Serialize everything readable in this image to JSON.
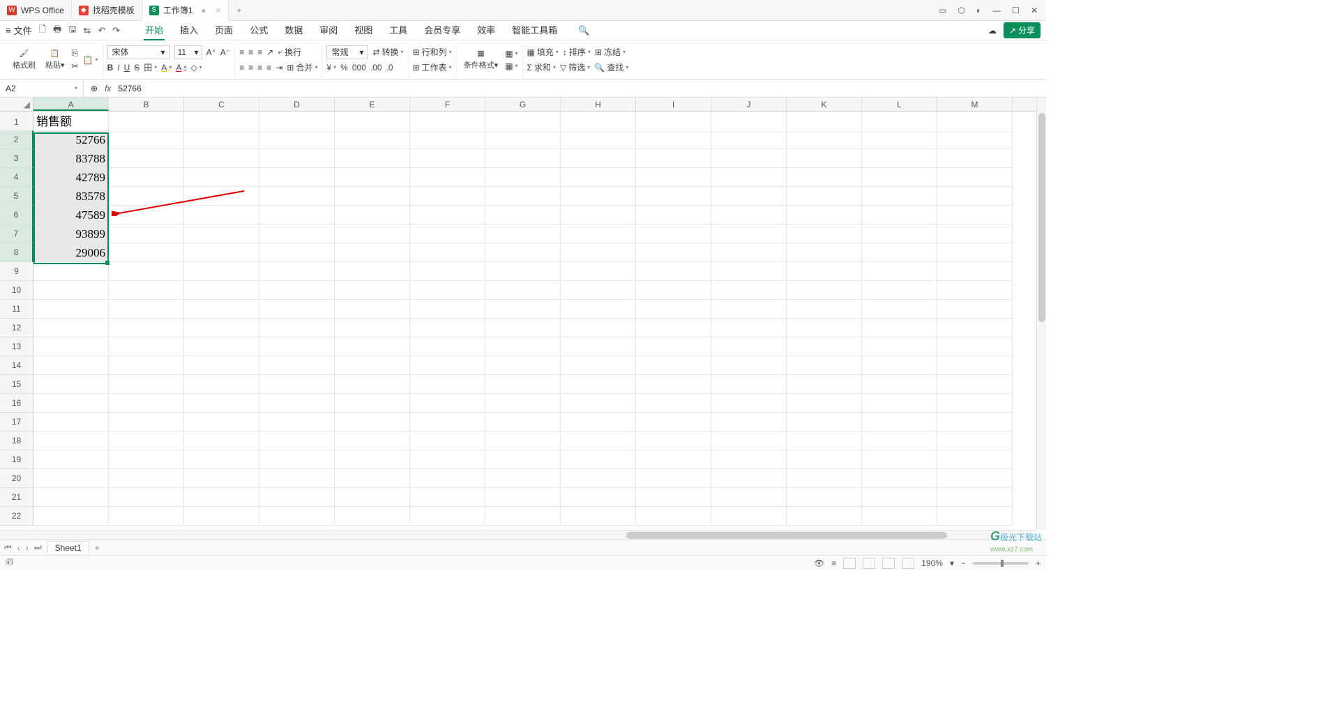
{
  "titlebar": {
    "tabs": [
      {
        "icon_bg": "#d23c2a",
        "icon_txt": "W",
        "label": "WPS Office"
      },
      {
        "icon_bg": "#e83f2e",
        "icon_txt": "◆",
        "label": "找稻壳模板"
      },
      {
        "icon_bg": "#0a8f5b",
        "icon_txt": "S",
        "label": "工作簿1",
        "active": true,
        "modified": "●"
      }
    ],
    "add": "+",
    "win": {
      "panel": "▭",
      "cube": "⬡",
      "avatar": "◐",
      "min": "—",
      "max": "☐",
      "close": "✕"
    }
  },
  "quickbar": {
    "menu_icon": "≡",
    "file_label": "文件",
    "icons": [
      "🗋",
      "🖶",
      "🖫",
      "⇆",
      "↶",
      "↷"
    ],
    "tabs": [
      "开始",
      "插入",
      "页面",
      "公式",
      "数据",
      "审阅",
      "视图",
      "工具",
      "会员专享",
      "效率",
      "智能工具箱"
    ],
    "active_tab": "开始",
    "search": "🔍",
    "cloud": "☁",
    "share_label": "分享"
  },
  "ribbon": {
    "clipboard": {
      "brush": "格式刷",
      "paste": "粘贴",
      "copy": "⎘",
      "cut": "✂"
    },
    "font": {
      "name": "宋体",
      "size": "11",
      "grow": "A⁺",
      "shrink": "A⁻",
      "bold": "B",
      "italic": "I",
      "uline": "U",
      "strike": "S",
      "borders": "田",
      "fill": "A",
      "color": "A",
      "clear": "◇"
    },
    "align": {
      "top": "≡",
      "mid": "≡",
      "bot": "≡",
      "orient": "↗",
      "wrap": "换行",
      "left": "≡",
      "center": "≡",
      "right": "≡",
      "just": "≡",
      "indent": "⇥",
      "merge": "合并"
    },
    "number": {
      "fmt": "常规",
      "convert": "转换",
      "cur": "¥",
      "pct": "%",
      "comma": "000",
      "inc": ".00",
      "dec": ".0"
    },
    "cells": {
      "rowcol": "行和列",
      "sheet": "工作表"
    },
    "style": {
      "cond": "条件格式",
      "cell": "▦"
    },
    "edit": {
      "fill": "填充",
      "sort": "排序",
      "freeze": "冻结",
      "sum": "求和",
      "filter": "筛选",
      "find": "查找"
    }
  },
  "formula_bar": {
    "cell": "A2",
    "fx": "fx",
    "value": "52766",
    "zoom": "⊕"
  },
  "grid": {
    "columns": [
      "A",
      "B",
      "C",
      "D",
      "E",
      "F",
      "G",
      "H",
      "I",
      "J",
      "K",
      "L",
      "M"
    ],
    "rows": 22,
    "header_cell": "销售额",
    "data": [
      "52766",
      "83788",
      "42789",
      "83578",
      "47589",
      "93899",
      "29006"
    ],
    "sel_col": "A",
    "sel_rows": [
      2,
      8
    ]
  },
  "sheettabs": {
    "nav": [
      "⏮",
      "‹",
      "›",
      "⏭"
    ],
    "sheet": "Sheet1",
    "add": "+"
  },
  "statusbar": {
    "ready": "🗊",
    "eye": "👁",
    "menu": "≡",
    "views": [
      "▦",
      "▥",
      "▤",
      "▣"
    ],
    "zoom": "190%",
    "minus": "−",
    "plus": "+"
  },
  "watermark": {
    "logo": "G",
    "text": "极光下载站",
    "url": "www.xz7.com"
  }
}
